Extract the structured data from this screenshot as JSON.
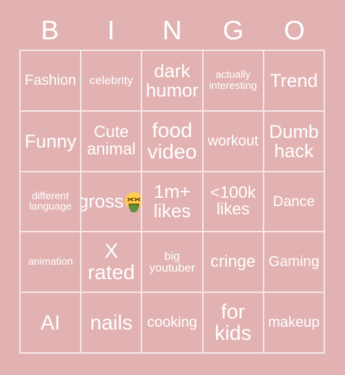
{
  "card": {
    "background_color": "#e2b1b1",
    "text_color": "#ffffff",
    "gridline_color": "#f7eaea",
    "header": {
      "letters": [
        "B",
        "I",
        "N",
        "G",
        "O"
      ]
    },
    "grid": {
      "columns": 5,
      "rows": 5,
      "cells": [
        {
          "text": "Fashion",
          "size": "md",
          "emoji": ""
        },
        {
          "text": "celebrity",
          "size": "sm",
          "emoji": ""
        },
        {
          "text": "dark\nhumor",
          "size": "xl",
          "emoji": ""
        },
        {
          "text": "actually\ninteresting",
          "size": "xs",
          "emoji": ""
        },
        {
          "text": "Trend",
          "size": "xl",
          "emoji": ""
        },
        {
          "text": "Funny",
          "size": "xl",
          "emoji": ""
        },
        {
          "text": "Cute\nanimal",
          "size": "lg",
          "emoji": ""
        },
        {
          "text": "food\nvideo",
          "size": "xxl",
          "emoji": ""
        },
        {
          "text": "workout",
          "size": "md",
          "emoji": ""
        },
        {
          "text": "Dumb\nhack",
          "size": "xl",
          "emoji": ""
        },
        {
          "text": "different\nlanguage",
          "size": "xs",
          "emoji": ""
        },
        {
          "text": "gross",
          "size": "xl",
          "emoji": "face-vomiting"
        },
        {
          "text": "1m+\nlikes",
          "size": "xl",
          "emoji": ""
        },
        {
          "text": "<100k\nlikes",
          "size": "lg",
          "emoji": ""
        },
        {
          "text": "Dance",
          "size": "md",
          "emoji": ""
        },
        {
          "text": "animation",
          "size": "xs",
          "emoji": ""
        },
        {
          "text": "X\nrated",
          "size": "xxl",
          "emoji": ""
        },
        {
          "text": "big\nyoutuber",
          "size": "sm",
          "emoji": ""
        },
        {
          "text": "cringe",
          "size": "lg",
          "emoji": ""
        },
        {
          "text": "Gaming",
          "size": "md",
          "emoji": ""
        },
        {
          "text": "AI",
          "size": "xxl",
          "emoji": ""
        },
        {
          "text": "nails",
          "size": "xxl",
          "emoji": ""
        },
        {
          "text": "cooking",
          "size": "md",
          "emoji": ""
        },
        {
          "text": "for\nkids",
          "size": "xxl",
          "emoji": ""
        },
        {
          "text": "makeup",
          "size": "md",
          "emoji": ""
        }
      ]
    }
  }
}
